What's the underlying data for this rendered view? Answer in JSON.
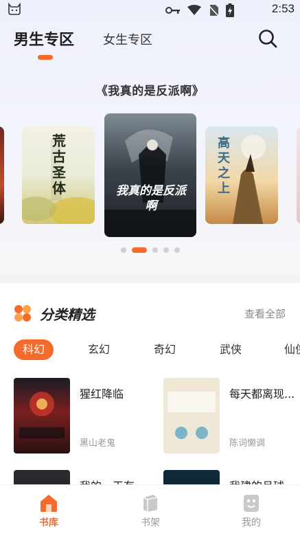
{
  "status_bar": {
    "time": "2:53"
  },
  "header": {
    "tabs": [
      {
        "label": "男生专区"
      },
      {
        "label": "女生专区"
      }
    ]
  },
  "featured": {
    "title": "《我真的是反派啊》",
    "covers": [
      {
        "text": "荒古圣体"
      },
      {
        "text": "我真的是反派啊"
      },
      {
        "text": "高天之上"
      }
    ],
    "active_index": 1,
    "dot_count": 5
  },
  "category": {
    "title": "分类精选",
    "see_all": "查看全部",
    "genres": [
      "科幻",
      "玄幻",
      "奇幻",
      "武侠",
      "仙侠"
    ],
    "active_genre": "科幻",
    "books": [
      {
        "name": "猩红降临",
        "author": "黑山老鬼"
      },
      {
        "name": "每天都离现...",
        "author": "陈词懒调"
      },
      {
        "name": "我的一天有...",
        "author": ""
      },
      {
        "name": "我建的月球...",
        "author": ""
      }
    ]
  },
  "bottom_nav": {
    "items": [
      {
        "label": "书库",
        "active": true
      },
      {
        "label": "书架",
        "active": false
      },
      {
        "label": "我的",
        "active": false
      }
    ]
  },
  "colors": {
    "accent": "#f46b2c",
    "inactive": "#999999"
  }
}
